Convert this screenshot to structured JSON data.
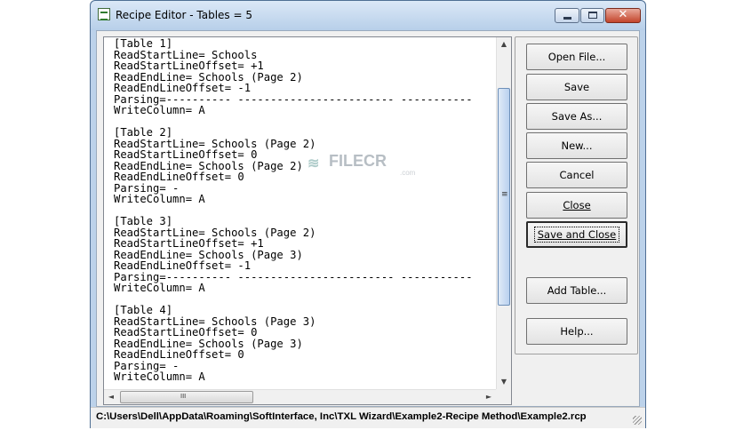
{
  "window": {
    "title": "Recipe Editor - Tables = 5",
    "close_glyph": "✕",
    "icon": "recipe-app-icon"
  },
  "editor": {
    "lines": [
      "[Table 1]",
      "ReadStartLine= Schools",
      "ReadStartLineOffset= +1",
      "ReadEndLine= Schools (Page 2)",
      "ReadEndLineOffset= -1",
      "Parsing=---------- ------------------------ -----------",
      "WriteColumn= A",
      "",
      "[Table 2]",
      "ReadStartLine= Schools (Page 2)",
      "ReadStartLineOffset= 0",
      "ReadEndLine= Schools (Page 2)",
      "ReadEndLineOffset= 0",
      "Parsing= -",
      "WriteColumn= A",
      "",
      "[Table 3]",
      "ReadStartLine= Schools (Page 2)",
      "ReadStartLineOffset= +1",
      "ReadEndLine= Schools (Page 3)",
      "ReadEndLineOffset= -1",
      "Parsing=---------- ------------------------ -----------",
      "WriteColumn= A",
      "",
      "[Table 4]",
      "ReadStartLine= Schools (Page 3)",
      "ReadStartLineOffset= 0",
      "ReadEndLine= Schools (Page 3)",
      "ReadEndLineOffset= 0",
      "Parsing= -",
      "WriteColumn= A"
    ],
    "vscroll_up": "▲",
    "vscroll_down": "▼",
    "vscroll_grip": "≡",
    "hscroll_left": "◄",
    "hscroll_right": "►",
    "hscroll_grip": "III"
  },
  "buttons": {
    "open_file": "Open File...",
    "save": "Save",
    "save_as": "Save As...",
    "new": "New...",
    "cancel": "Cancel",
    "close": "Close",
    "save_and_close": "Save and Close",
    "add_table": "Add Table...",
    "help": "Help..."
  },
  "status_bar": {
    "path": "C:\\Users\\Dell\\AppData\\Roaming\\SoftInterface, Inc\\TXL Wizard\\Example2-Recipe Method\\Example2.rcp"
  },
  "watermark": {
    "brand": "FILECR",
    "suffix": ".com"
  }
}
